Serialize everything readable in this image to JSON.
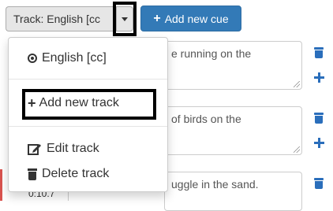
{
  "toolbar": {
    "track_label": "Track: English [cc",
    "add_cue_label": "Add new cue"
  },
  "cues": [
    {
      "text": "e running on the"
    },
    {
      "text": "of birds on the"
    },
    {
      "text": "uggle in the sand."
    }
  ],
  "timestamp": "0:10.7",
  "menu": {
    "items": [
      {
        "label": "English [cc]",
        "icon": "radio-checked-icon"
      },
      {
        "label": "Add new track",
        "icon": "plus-icon"
      },
      {
        "label": "Edit track",
        "icon": "edit-icon"
      },
      {
        "label": "Delete track",
        "icon": "trash-icon"
      }
    ]
  },
  "colors": {
    "primary": "#337ab7",
    "icon_blue": "#2a6ebb",
    "highlight_border": "#000000",
    "marker_red": "#d9534f"
  }
}
